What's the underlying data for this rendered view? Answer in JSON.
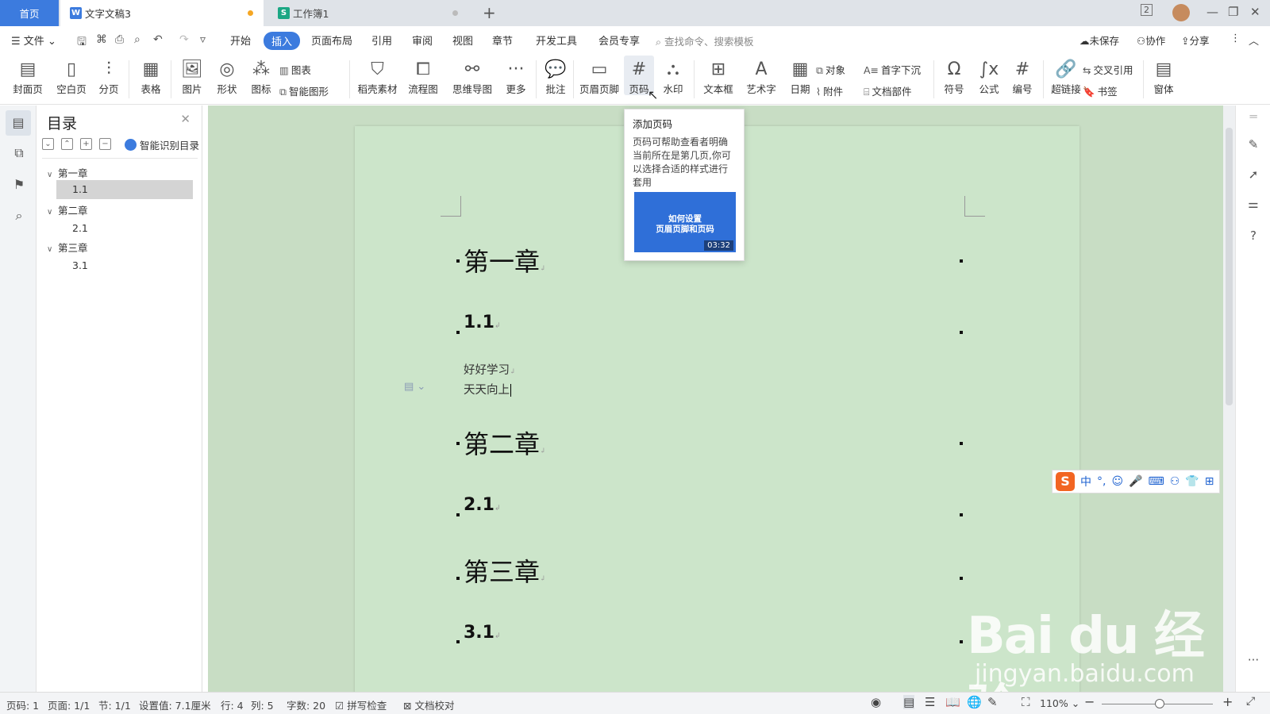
{
  "titlebar": {
    "home_tab": "首页",
    "doc_tab": "文字文稿3",
    "sheet_tab": "工作簿1",
    "new_tab_icon": "plus-icon",
    "window_count": "2",
    "doc_icon_letter": "W",
    "sheet_icon_letter": "S",
    "unsaved_dot_color": "#f5a623"
  },
  "menubar": {
    "file": "文件",
    "tabs": [
      "开始",
      "插入",
      "页面布局",
      "引用",
      "审阅",
      "视图",
      "章节",
      "开发工具",
      "会员专享"
    ],
    "active_tab": "插入",
    "search_placeholder": "查找命令、搜索模板",
    "unsaved": "未保存",
    "collaborate": "协作",
    "share": "分享"
  },
  "ribbon": {
    "cover": "封面页",
    "blank": "空白页",
    "break": "分页",
    "table": "表格",
    "picture": "图片",
    "shape": "形状",
    "icons": "图标",
    "chart": "图表",
    "smart_art": "智能图形",
    "docer": "稻壳素材",
    "flowchart": "流程图",
    "mindmap": "思维导图",
    "more": "更多",
    "comment": "批注",
    "header_footer": "页眉页脚",
    "page_number": "页码",
    "watermark": "水印",
    "textbox": "文本框",
    "wordart": "艺术字",
    "date": "日期",
    "object": "对象",
    "attachment": "附件",
    "dropcap": "首字下沉",
    "doc_parts": "文档部件",
    "symbol": "符号",
    "formula": "公式",
    "numbering": "编号",
    "hyperlink": "超链接",
    "crossref": "交叉引用",
    "bookmark": "书签",
    "form": "窗体"
  },
  "navpane": {
    "title": "目录",
    "smart_toc": "智能识别目录",
    "items": [
      {
        "label": "第一章"
      },
      {
        "label": "1.1"
      },
      {
        "label": "第二章"
      },
      {
        "label": "2.1"
      },
      {
        "label": "第三章"
      },
      {
        "label": "3.1"
      }
    ]
  },
  "document": {
    "h1": "第一章",
    "s1": "1.1",
    "line1": "好好学习",
    "line2": "天天向上",
    "h2": "第二章",
    "s2": "2.1",
    "h3": "第三章",
    "s3": "3.1",
    "para_mark": "↲",
    "page_color": "#cce5ca"
  },
  "tooltip": {
    "title": "添加页码",
    "description": "页码可帮助查看者明确当前所在是第几页,你可以选择合适的样式进行套用",
    "video_title_1": "如何设置",
    "video_title_2": "页眉页脚和页码",
    "video_duration": "03:32"
  },
  "ime": {
    "logo": "S",
    "mode": "中",
    "punct": "°,"
  },
  "watermark_overlay": {
    "brand": "Bai du 经验",
    "url": "jingyan.baidu.com"
  },
  "statusbar": {
    "page_num": "页码: 1",
    "page": "页面: 1/1",
    "section": "节: 1/1",
    "setting": "设置值: 7.1厘米",
    "row": "行: 4",
    "col": "列: 5",
    "words": "字数: 20",
    "spellcheck": "拼写检查",
    "proofread": "文档校对",
    "zoom": "110%"
  },
  "colors": {
    "accent": "#3c7bde",
    "doc_bg": "#c8ddc4"
  }
}
